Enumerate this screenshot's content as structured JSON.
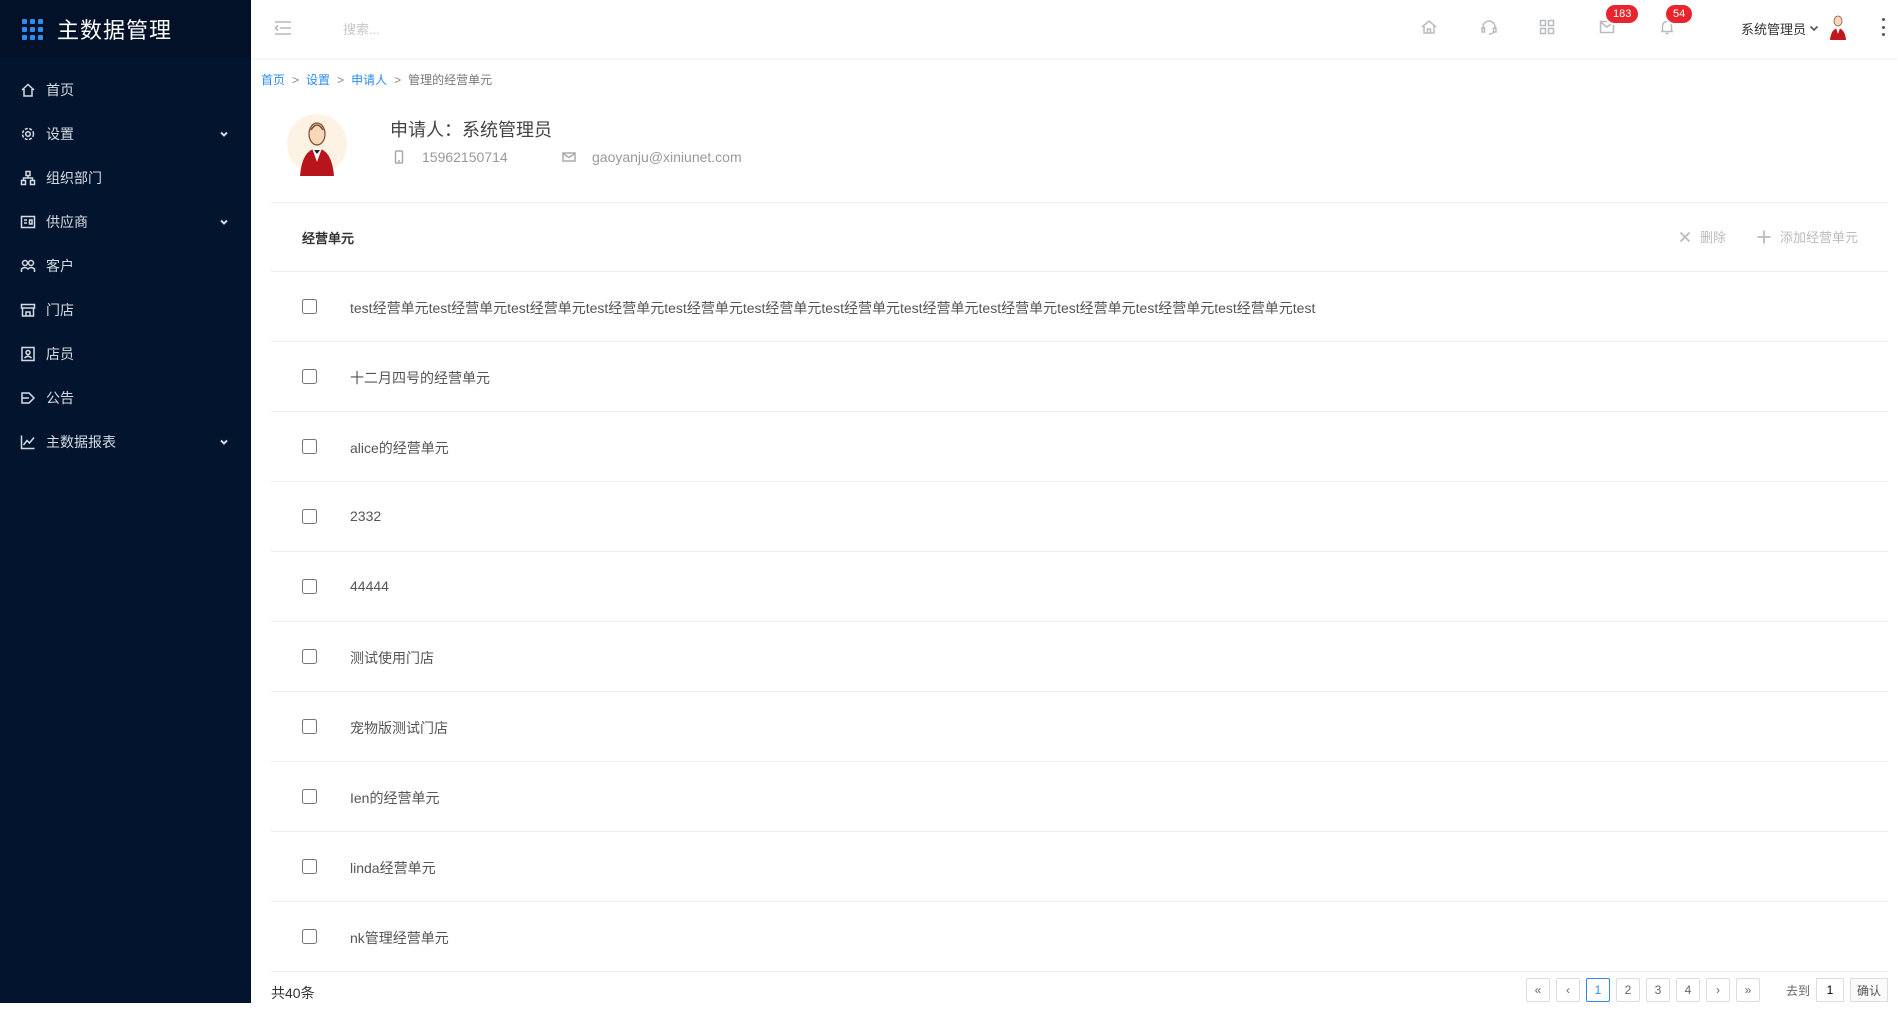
{
  "app": {
    "title": "主数据管理"
  },
  "sidebar": {
    "items": [
      {
        "label": "首页",
        "icon": "home-icon",
        "expandable": false
      },
      {
        "label": "设置",
        "icon": "gear-icon",
        "expandable": true
      },
      {
        "label": "组织部门",
        "icon": "org-tree-icon",
        "expandable": false
      },
      {
        "label": "供应商",
        "icon": "supplier-icon",
        "expandable": true
      },
      {
        "label": "客户",
        "icon": "customer-icon",
        "expandable": false
      },
      {
        "label": "门店",
        "icon": "store-icon",
        "expandable": false
      },
      {
        "label": "店员",
        "icon": "clerk-icon",
        "expandable": false
      },
      {
        "label": "公告",
        "icon": "announcement-icon",
        "expandable": false
      },
      {
        "label": "主数据报表",
        "icon": "chart-line-icon",
        "expandable": true
      }
    ]
  },
  "header": {
    "search_placeholder": "搜索...",
    "messages_badge": "183",
    "notifications_badge": "54",
    "user_name": "系统管理员"
  },
  "breadcrumb": {
    "items": [
      "首页",
      "设置",
      "申请人",
      "管理的经营单元"
    ]
  },
  "profile": {
    "applicant": "申请人：系统管理员",
    "phone": "15962150714",
    "email": "gaoyanju@xiniunet.com"
  },
  "section": {
    "title": "经营单元",
    "delete_label": "删除",
    "add_label": "添加经营单元"
  },
  "rows": [
    "test经营单元test经营单元test经营单元test经营单元test经营单元test经营单元test经营单元test经营单元test经营单元test经营单元test经营单元test经营单元test",
    "十二月四号的经营单元",
    "alice的经营单元",
    "2332",
    "44444",
    "测试使用门店",
    "宠物版测试门店",
    "Ien的经营单元",
    "linda经营单元",
    "nk管理经营单元"
  ],
  "pagination": {
    "total": "共40条",
    "first": "«",
    "prev": "‹",
    "pages": [
      "1",
      "2",
      "3",
      "4"
    ],
    "current_page": "1",
    "next": "›",
    "last": "»",
    "goto_label": "去到",
    "goto_value": "1",
    "confirm_label": "确认"
  },
  "colors": {
    "sidebar_bg": "#03152e",
    "accent": "#2d8cf0",
    "badge": "#e8242c"
  }
}
